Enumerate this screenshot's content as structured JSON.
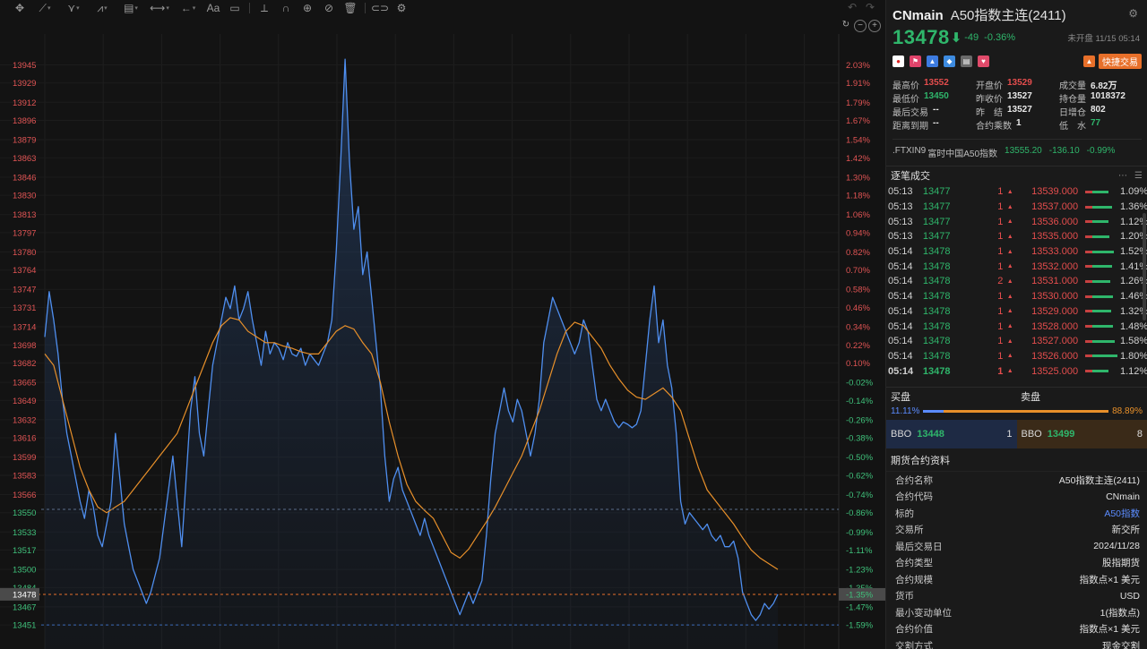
{
  "toolbar": {
    "icons": [
      "move-icon",
      "trend-line-icon",
      "pitchfork-icon",
      "zigzag-icon",
      "fib-icon",
      "measure-icon",
      "arrow-icon",
      "text-icon",
      "note-icon",
      "eraser-icon",
      "magnet-icon",
      "globe-icon",
      "hide-icon",
      "trash-icon",
      "link-icon",
      "settings-icon"
    ],
    "text_tool_label": "Aa"
  },
  "chart_data": {
    "type": "area",
    "title": "",
    "xlabel": "",
    "ylabel": "",
    "ylim": [
      13444,
      13958
    ],
    "y_ticks": [
      "13945",
      "13929",
      "13912",
      "13896",
      "13879",
      "13863",
      "13846",
      "13830",
      "13813",
      "13797",
      "13780",
      "13764",
      "13747",
      "13731",
      "13714",
      "13698",
      "13682",
      "13665",
      "13649",
      "13632",
      "13616",
      "13599",
      "13583",
      "13566",
      "13550",
      "13533",
      "13517",
      "13500",
      "13484",
      "13467",
      "13451"
    ],
    "pct_ticks": [
      "2.03%",
      "1.91%",
      "1.79%",
      "1.67%",
      "1.54%",
      "1.42%",
      "1.30%",
      "1.18%",
      "1.06%",
      "0.94%",
      "0.82%",
      "0.70%",
      "0.58%",
      "0.46%",
      "0.34%",
      "0.22%",
      "0.10%",
      "-0.02%",
      "-0.14%",
      "-0.26%",
      "-0.38%",
      "-0.50%",
      "-0.62%",
      "-0.74%",
      "-0.86%",
      "-0.99%",
      "-1.11%",
      "-1.23%",
      "-1.35%",
      "-1.47%",
      "-1.59%"
    ],
    "prev_close": 13553,
    "last_price": 13478,
    "last_label": "13478",
    "last_pct_label": "-1.35%",
    "price_series": [
      [
        0,
        13705
      ],
      [
        1,
        13745
      ],
      [
        2,
        13720
      ],
      [
        3,
        13690
      ],
      [
        4,
        13650
      ],
      [
        5,
        13620
      ],
      [
        6,
        13600
      ],
      [
        7,
        13580
      ],
      [
        8,
        13560
      ],
      [
        9,
        13545
      ],
      [
        10,
        13570
      ],
      [
        11,
        13555
      ],
      [
        12,
        13530
      ],
      [
        13,
        13520
      ],
      [
        14,
        13540
      ],
      [
        15,
        13560
      ],
      [
        16,
        13620
      ],
      [
        17,
        13580
      ],
      [
        18,
        13540
      ],
      [
        19,
        13520
      ],
      [
        20,
        13500
      ],
      [
        21,
        13490
      ],
      [
        22,
        13480
      ],
      [
        23,
        13470
      ],
      [
        24,
        13480
      ],
      [
        25,
        13495
      ],
      [
        26,
        13510
      ],
      [
        27,
        13540
      ],
      [
        28,
        13570
      ],
      [
        29,
        13600
      ],
      [
        30,
        13560
      ],
      [
        31,
        13520
      ],
      [
        32,
        13580
      ],
      [
        33,
        13640
      ],
      [
        34,
        13670
      ],
      [
        35,
        13620
      ],
      [
        36,
        13600
      ],
      [
        37,
        13640
      ],
      [
        38,
        13680
      ],
      [
        39,
        13700
      ],
      [
        40,
        13720
      ],
      [
        41,
        13740
      ],
      [
        42,
        13730
      ],
      [
        43,
        13750
      ],
      [
        44,
        13720
      ],
      [
        45,
        13730
      ],
      [
        46,
        13745
      ],
      [
        47,
        13720
      ],
      [
        48,
        13700
      ],
      [
        49,
        13680
      ],
      [
        50,
        13710
      ],
      [
        51,
        13690
      ],
      [
        52,
        13700
      ],
      [
        53,
        13695
      ],
      [
        54,
        13685
      ],
      [
        55,
        13700
      ],
      [
        56,
        13690
      ],
      [
        57,
        13688
      ],
      [
        58,
        13695
      ],
      [
        59,
        13680
      ],
      [
        60,
        13690
      ],
      [
        61,
        13685
      ],
      [
        62,
        13680
      ],
      [
        63,
        13690
      ],
      [
        64,
        13700
      ],
      [
        65,
        13720
      ],
      [
        66,
        13780
      ],
      [
        67,
        13860
      ],
      [
        68,
        13950
      ],
      [
        69,
        13860
      ],
      [
        70,
        13800
      ],
      [
        71,
        13820
      ],
      [
        72,
        13760
      ],
      [
        73,
        13780
      ],
      [
        74,
        13740
      ],
      [
        75,
        13700
      ],
      [
        76,
        13660
      ],
      [
        77,
        13600
      ],
      [
        78,
        13560
      ],
      [
        79,
        13580
      ],
      [
        80,
        13590
      ],
      [
        81,
        13570
      ],
      [
        82,
        13560
      ],
      [
        83,
        13550
      ],
      [
        84,
        13540
      ],
      [
        85,
        13530
      ],
      [
        86,
        13545
      ],
      [
        87,
        13530
      ],
      [
        88,
        13520
      ],
      [
        89,
        13510
      ],
      [
        90,
        13500
      ],
      [
        91,
        13490
      ],
      [
        92,
        13480
      ],
      [
        93,
        13470
      ],
      [
        94,
        13460
      ],
      [
        95,
        13470
      ],
      [
        96,
        13480
      ],
      [
        97,
        13470
      ],
      [
        98,
        13480
      ],
      [
        99,
        13490
      ],
      [
        100,
        13530
      ],
      [
        101,
        13580
      ],
      [
        102,
        13620
      ],
      [
        103,
        13640
      ],
      [
        104,
        13660
      ],
      [
        105,
        13640
      ],
      [
        106,
        13630
      ],
      [
        107,
        13650
      ],
      [
        108,
        13640
      ],
      [
        109,
        13620
      ],
      [
        110,
        13600
      ],
      [
        111,
        13620
      ],
      [
        112,
        13650
      ],
      [
        113,
        13700
      ],
      [
        114,
        13720
      ],
      [
        115,
        13740
      ],
      [
        116,
        13730
      ],
      [
        117,
        13720
      ],
      [
        118,
        13710
      ],
      [
        119,
        13700
      ],
      [
        120,
        13690
      ],
      [
        121,
        13700
      ],
      [
        122,
        13720
      ],
      [
        123,
        13710
      ],
      [
        124,
        13680
      ],
      [
        125,
        13650
      ],
      [
        126,
        13640
      ],
      [
        127,
        13650
      ],
      [
        128,
        13640
      ],
      [
        129,
        13630
      ],
      [
        130,
        13625
      ],
      [
        131,
        13630
      ],
      [
        132,
        13628
      ],
      [
        133,
        13625
      ],
      [
        134,
        13628
      ],
      [
        135,
        13640
      ],
      [
        136,
        13680
      ],
      [
        137,
        13720
      ],
      [
        138,
        13750
      ],
      [
        139,
        13700
      ],
      [
        140,
        13720
      ],
      [
        141,
        13680
      ],
      [
        142,
        13660
      ],
      [
        143,
        13620
      ],
      [
        144,
        13560
      ],
      [
        145,
        13540
      ],
      [
        146,
        13550
      ],
      [
        147,
        13545
      ],
      [
        148,
        13540
      ],
      [
        149,
        13535
      ],
      [
        150,
        13540
      ],
      [
        151,
        13530
      ],
      [
        152,
        13525
      ],
      [
        153,
        13530
      ],
      [
        154,
        13520
      ],
      [
        155,
        13520
      ],
      [
        156,
        13525
      ],
      [
        157,
        13510
      ],
      [
        158,
        13480
      ],
      [
        159,
        13470
      ],
      [
        160,
        13460
      ],
      [
        161,
        13455
      ],
      [
        162,
        13460
      ],
      [
        163,
        13470
      ],
      [
        164,
        13465
      ],
      [
        165,
        13470
      ],
      [
        166,
        13478
      ]
    ],
    "ma_series": [
      [
        0,
        13690
      ],
      [
        2,
        13680
      ],
      [
        4,
        13650
      ],
      [
        6,
        13620
      ],
      [
        8,
        13590
      ],
      [
        10,
        13570
      ],
      [
        12,
        13555
      ],
      [
        14,
        13550
      ],
      [
        16,
        13555
      ],
      [
        18,
        13560
      ],
      [
        20,
        13570
      ],
      [
        22,
        13580
      ],
      [
        24,
        13590
      ],
      [
        26,
        13600
      ],
      [
        28,
        13610
      ],
      [
        30,
        13620
      ],
      [
        32,
        13640
      ],
      [
        34,
        13660
      ],
      [
        36,
        13680
      ],
      [
        38,
        13700
      ],
      [
        40,
        13715
      ],
      [
        42,
        13722
      ],
      [
        44,
        13720
      ],
      [
        46,
        13710
      ],
      [
        48,
        13705
      ],
      [
        50,
        13700
      ],
      [
        52,
        13700
      ],
      [
        54,
        13697
      ],
      [
        56,
        13695
      ],
      [
        58,
        13692
      ],
      [
        60,
        13690
      ],
      [
        62,
        13690
      ],
      [
        64,
        13700
      ],
      [
        66,
        13710
      ],
      [
        68,
        13715
      ],
      [
        70,
        13712
      ],
      [
        72,
        13700
      ],
      [
        74,
        13690
      ],
      [
        76,
        13665
      ],
      [
        78,
        13630
      ],
      [
        80,
        13600
      ],
      [
        82,
        13575
      ],
      [
        84,
        13560
      ],
      [
        86,
        13552
      ],
      [
        88,
        13545
      ],
      [
        90,
        13530
      ],
      [
        92,
        13515
      ],
      [
        94,
        13510
      ],
      [
        96,
        13518
      ],
      [
        98,
        13530
      ],
      [
        100,
        13542
      ],
      [
        102,
        13555
      ],
      [
        104,
        13570
      ],
      [
        106,
        13585
      ],
      [
        108,
        13600
      ],
      [
        110,
        13620
      ],
      [
        112,
        13640
      ],
      [
        114,
        13665
      ],
      [
        116,
        13690
      ],
      [
        118,
        13710
      ],
      [
        120,
        13718
      ],
      [
        122,
        13715
      ],
      [
        124,
        13705
      ],
      [
        126,
        13695
      ],
      [
        128,
        13680
      ],
      [
        130,
        13668
      ],
      [
        132,
        13658
      ],
      [
        134,
        13652
      ],
      [
        136,
        13650
      ],
      [
        138,
        13655
      ],
      [
        140,
        13660
      ],
      [
        142,
        13652
      ],
      [
        144,
        13640
      ],
      [
        146,
        13615
      ],
      [
        148,
        13590
      ],
      [
        150,
        13570
      ],
      [
        152,
        13560
      ],
      [
        154,
        13550
      ],
      [
        156,
        13540
      ],
      [
        158,
        13528
      ],
      [
        160,
        13517
      ],
      [
        162,
        13510
      ],
      [
        164,
        13505
      ],
      [
        166,
        13500
      ]
    ]
  },
  "panel": {
    "symbol": "CNmain",
    "name": "A50指数主连(2411)",
    "last_price": "13478",
    "change": "-49",
    "change_pct": "-0.36%",
    "status": "未开盘 11/15 05:14",
    "quick_trade": "快捷交易",
    "stats": [
      {
        "k": "最高价",
        "v": "13552",
        "c": "red"
      },
      {
        "k": "开盘价",
        "v": "13529",
        "c": "red"
      },
      {
        "k": "成交量",
        "v": "6.82万",
        "c": ""
      },
      {
        "k": "最低价",
        "v": "13450",
        "c": "green"
      },
      {
        "k": "昨收价",
        "v": "13527",
        "c": ""
      },
      {
        "k": "持仓量",
        "v": "1018372",
        "c": ""
      },
      {
        "k": "最后交易",
        "v": "--",
        "c": ""
      },
      {
        "k": "昨　结",
        "v": "13527",
        "c": ""
      },
      {
        "k": "日增仓",
        "v": "802",
        "c": ""
      },
      {
        "k": "距离到期",
        "v": "--",
        "c": ""
      },
      {
        "k": "合约乘数",
        "v": "1",
        "c": ""
      },
      {
        "k": "低　水",
        "v": "77",
        "c": "green"
      }
    ],
    "ref": {
      "code": ".FTXIN9",
      "name": "富时中国A50指数",
      "price": "13555.20",
      "change": "-136.10",
      "pct": "-0.99%"
    },
    "tape_title": "逐笔成交",
    "tape": [
      {
        "t": "05:13",
        "p": "13477",
        "q": "1",
        "lp": "13539.000",
        "g": 18,
        "pc": "1.09%"
      },
      {
        "t": "05:13",
        "p": "13477",
        "q": "1",
        "lp": "13537.000",
        "g": 22,
        "pc": "1.36%"
      },
      {
        "t": "05:13",
        "p": "13477",
        "q": "1",
        "lp": "13536.000",
        "g": 18,
        "pc": "1.12%"
      },
      {
        "t": "05:13",
        "p": "13477",
        "q": "1",
        "lp": "13535.000",
        "g": 19,
        "pc": "1.20%"
      },
      {
        "t": "05:14",
        "p": "13478",
        "q": "1",
        "lp": "13533.000",
        "g": 24,
        "pc": "1.52%"
      },
      {
        "t": "05:14",
        "p": "13478",
        "q": "1",
        "lp": "13532.000",
        "g": 22,
        "pc": "1.41%"
      },
      {
        "t": "05:14",
        "p": "13478",
        "q": "2",
        "lp": "13531.000",
        "g": 20,
        "pc": "1.26%"
      },
      {
        "t": "05:14",
        "p": "13478",
        "q": "1",
        "lp": "13530.000",
        "g": 23,
        "pc": "1.46%"
      },
      {
        "t": "05:14",
        "p": "13478",
        "q": "1",
        "lp": "13529.000",
        "g": 21,
        "pc": "1.32%"
      },
      {
        "t": "05:14",
        "p": "13478",
        "q": "1",
        "lp": "13528.000",
        "g": 23,
        "pc": "1.48%"
      },
      {
        "t": "05:14",
        "p": "13478",
        "q": "1",
        "lp": "13527.000",
        "g": 25,
        "pc": "1.58%"
      },
      {
        "t": "05:14",
        "p": "13478",
        "q": "1",
        "lp": "13526.000",
        "g": 28,
        "pc": "1.80%"
      },
      {
        "t": "05:14",
        "p": "13478",
        "q": "1",
        "lp": "13525.000",
        "g": 18,
        "pc": "1.12%"
      }
    ],
    "orderbook": {
      "bid_label": "买盘",
      "ask_label": "卖盘",
      "bid_pct": "11.11%",
      "ask_pct": "88.89%",
      "bid_ratio": 0.1111,
      "bbo_bid": {
        "label": "BBO",
        "price": "13448",
        "qty": "1"
      },
      "bbo_ask": {
        "label": "BBO",
        "price": "13499",
        "qty": "8"
      }
    },
    "info_title": "期货合约资料",
    "info": [
      {
        "k": "合约名称",
        "v": "A50指数主连(2411)",
        "link": false
      },
      {
        "k": "合约代码",
        "v": "CNmain",
        "link": false
      },
      {
        "k": "标的",
        "v": "A50指数",
        "link": true
      },
      {
        "k": "交易所",
        "v": "新交所",
        "link": false
      },
      {
        "k": "最后交易日",
        "v": "2024/11/28",
        "link": false
      },
      {
        "k": "合约类型",
        "v": "股指期货",
        "link": false
      },
      {
        "k": "合约规模",
        "v": "指数点×1 美元",
        "link": false
      },
      {
        "k": "货币",
        "v": "USD",
        "link": false
      },
      {
        "k": "最小变动单位",
        "v": "1(指数点)",
        "link": false
      },
      {
        "k": "合约价值",
        "v": "指数点×1 美元",
        "link": false
      },
      {
        "k": "交割方式",
        "v": "现金交割",
        "link": false
      }
    ]
  }
}
